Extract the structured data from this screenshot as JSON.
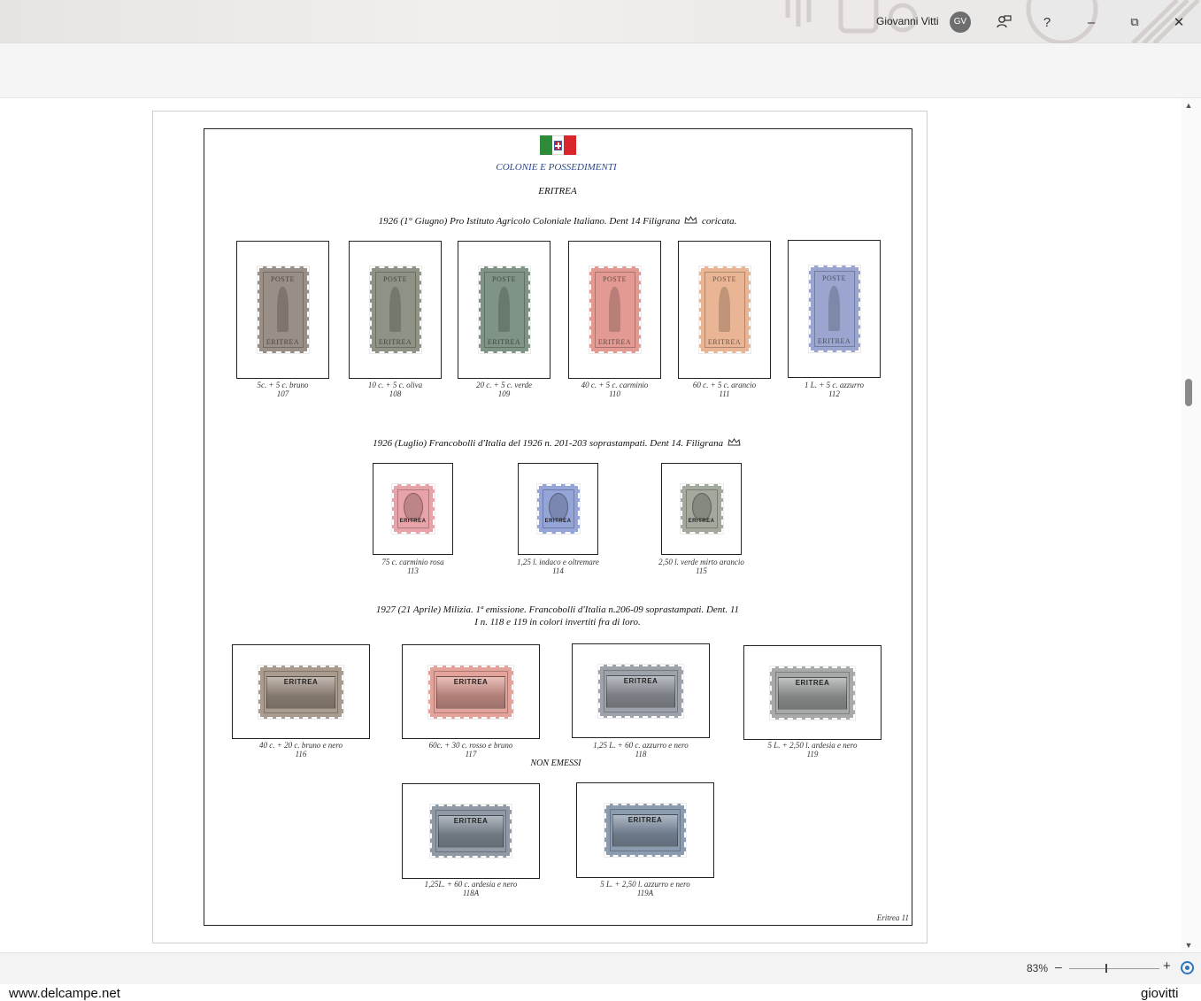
{
  "titlebar": {
    "user_name": "Giovanni Vitti",
    "avatar_initials": "GV",
    "help": "?",
    "minimize": "–",
    "restore": "⧉",
    "close": "✕"
  },
  "document": {
    "header_title": "COLONIE E POSSEDIMENTI",
    "country": "ERITREA",
    "footer": "Eritrea 11",
    "sections": [
      {
        "title_before": "1926 (1° Giugno) Pro Istituto Agricolo Coloniale Italiano. Dent 14 Filigrana",
        "title_after": "coricata.",
        "stamps": [
          {
            "desc": "5c. + 5 c. bruno",
            "num": "107",
            "color": "#9a8f86",
            "label": "POSTE",
            "bottom": "ERITREA"
          },
          {
            "desc": "10 c. + 5 c. oliva",
            "num": "108",
            "color": "#8f9385",
            "label": "POSTE",
            "bottom": "ERITREA"
          },
          {
            "desc": "20 c. + 5 c. verde",
            "num": "109",
            "color": "#7f9486",
            "label": "POSTE",
            "bottom": "ERITREA"
          },
          {
            "desc": "40 c. + 5 c. carminio",
            "num": "110",
            "color": "#e39a93",
            "label": "POSTE",
            "bottom": "ERITREA"
          },
          {
            "desc": "60 c. + 5 c. arancio",
            "num": "111",
            "color": "#eab594",
            "label": "POSTE",
            "bottom": "ERITREA"
          },
          {
            "desc": "1 L. + 5 c. azzurro",
            "num": "112",
            "color": "#9aa6cf",
            "label": "POSTE",
            "bottom": "ERITREA"
          }
        ]
      },
      {
        "title_before": "1926 (Luglio) Francobolli d'Italia del 1926 n. 201-203 soprastampati. Dent 14. Filigrana",
        "title_after": "",
        "stamps": [
          {
            "desc": "75 c. carminio rosa",
            "num": "113",
            "color": "#e8a3a8",
            "overprint": "ERITREA"
          },
          {
            "desc": "1,25 l. indaco e oltremare",
            "num": "114",
            "color": "#95a5d8",
            "overprint": "ERITREA"
          },
          {
            "desc": "2,50 l. verde mirto arancio",
            "num": "115",
            "color": "#a3a99d",
            "overprint": "ERITREA"
          }
        ]
      },
      {
        "title_line1": "1927 (21 Aprile) Milizia. 1ª emissione. Francobolli d'Italia n.206-09 soprastampati. Dent. 11",
        "title_line2": "I n. 118 e 119 in colori invertiti fra di loro.",
        "stamps": [
          {
            "desc": "40 c. + 20 c. bruno e nero",
            "num": "116",
            "color": "#a99b8e",
            "overprint": "ERITREA"
          },
          {
            "desc": "60c. + 30 c. rosso e bruno",
            "num": "117",
            "color": "#e3a39a",
            "overprint": "ERITREA"
          },
          {
            "desc": "1,25 L. + 60 c. azzurro e nero",
            "num": "118",
            "color": "#9ea3ab",
            "overprint": "ERITREA"
          },
          {
            "desc": "5 L. + 2,50 l. ardesia e nero",
            "num": "119",
            "color": "#a7aaa8",
            "overprint": "ERITREA"
          }
        ],
        "non_emessi_label": "NON EMESSI",
        "non_emessi": [
          {
            "desc": "1,25L. + 60 c. ardesia e nero",
            "num": "118A",
            "color": "#8f9aa6",
            "overprint": "ERITREA"
          },
          {
            "desc": "5 L. + 2,50 l. azzurro e nero",
            "num": "119A",
            "color": "#8c9cb0",
            "overprint": "ERITREA"
          }
        ]
      }
    ]
  },
  "statusbar": {
    "zoom": "83%",
    "zoom_minus": "–",
    "zoom_plus": "+",
    "zoom_level": 0.83
  },
  "watermark": {
    "left": "www.delcampe.net",
    "right": "giovitti"
  },
  "icons": {
    "avatar": "avatar-circle",
    "feedback": "feedback-icon",
    "help": "help-icon",
    "minimize": "minimize-icon",
    "restore": "restore-icon",
    "close": "close-icon",
    "crown": "crown-icon",
    "fit": "fit-page-icon"
  }
}
